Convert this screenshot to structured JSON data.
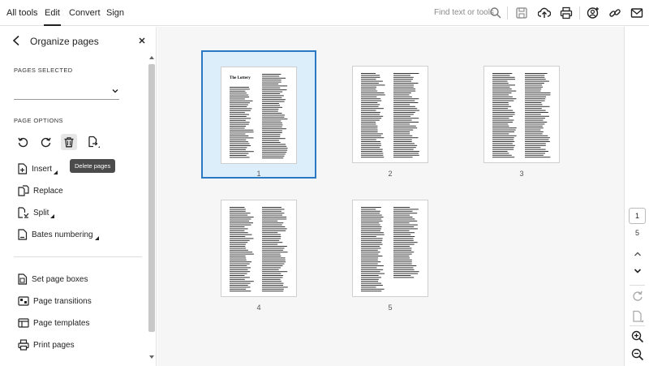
{
  "menu": {
    "tabs": [
      "All tools",
      "Edit",
      "Convert",
      "Sign"
    ],
    "active_tab": "Edit"
  },
  "search": {
    "placeholder": "Find text or tools"
  },
  "panel": {
    "title": "Organize pages",
    "pages_selected_label": "PAGES SELECTED",
    "pages_selected_value": "",
    "page_options_label": "PAGE OPTIONS",
    "tooltip": "Delete pages",
    "tools": [
      {
        "label": "Insert",
        "icon": "insert-page-icon",
        "has_menu": true
      },
      {
        "label": "Replace",
        "icon": "replace-page-icon",
        "has_menu": false
      },
      {
        "label": "Split",
        "icon": "split-icon",
        "has_menu": true
      },
      {
        "label": "Bates numbering",
        "icon": "bates-numbering-icon",
        "has_menu": true
      }
    ],
    "more_tools": [
      {
        "label": "Set page boxes",
        "icon": "page-boxes-icon"
      },
      {
        "label": "Page transitions",
        "icon": "page-transitions-icon"
      },
      {
        "label": "Page templates",
        "icon": "page-templates-icon"
      },
      {
        "label": "Print pages",
        "icon": "printer-icon"
      }
    ]
  },
  "thumbnails": [
    {
      "number": "1",
      "selected": true,
      "heading": "The Lottery"
    },
    {
      "number": "2",
      "selected": false
    },
    {
      "number": "3",
      "selected": false
    },
    {
      "number": "4",
      "selected": false
    },
    {
      "number": "5",
      "selected": false
    }
  ],
  "pager": {
    "current": "1",
    "total": "5"
  },
  "colors": {
    "accent": "#2b79c2",
    "selected_bg": "#ddeefb",
    "tooltip_bg": "#4b4b4b"
  }
}
